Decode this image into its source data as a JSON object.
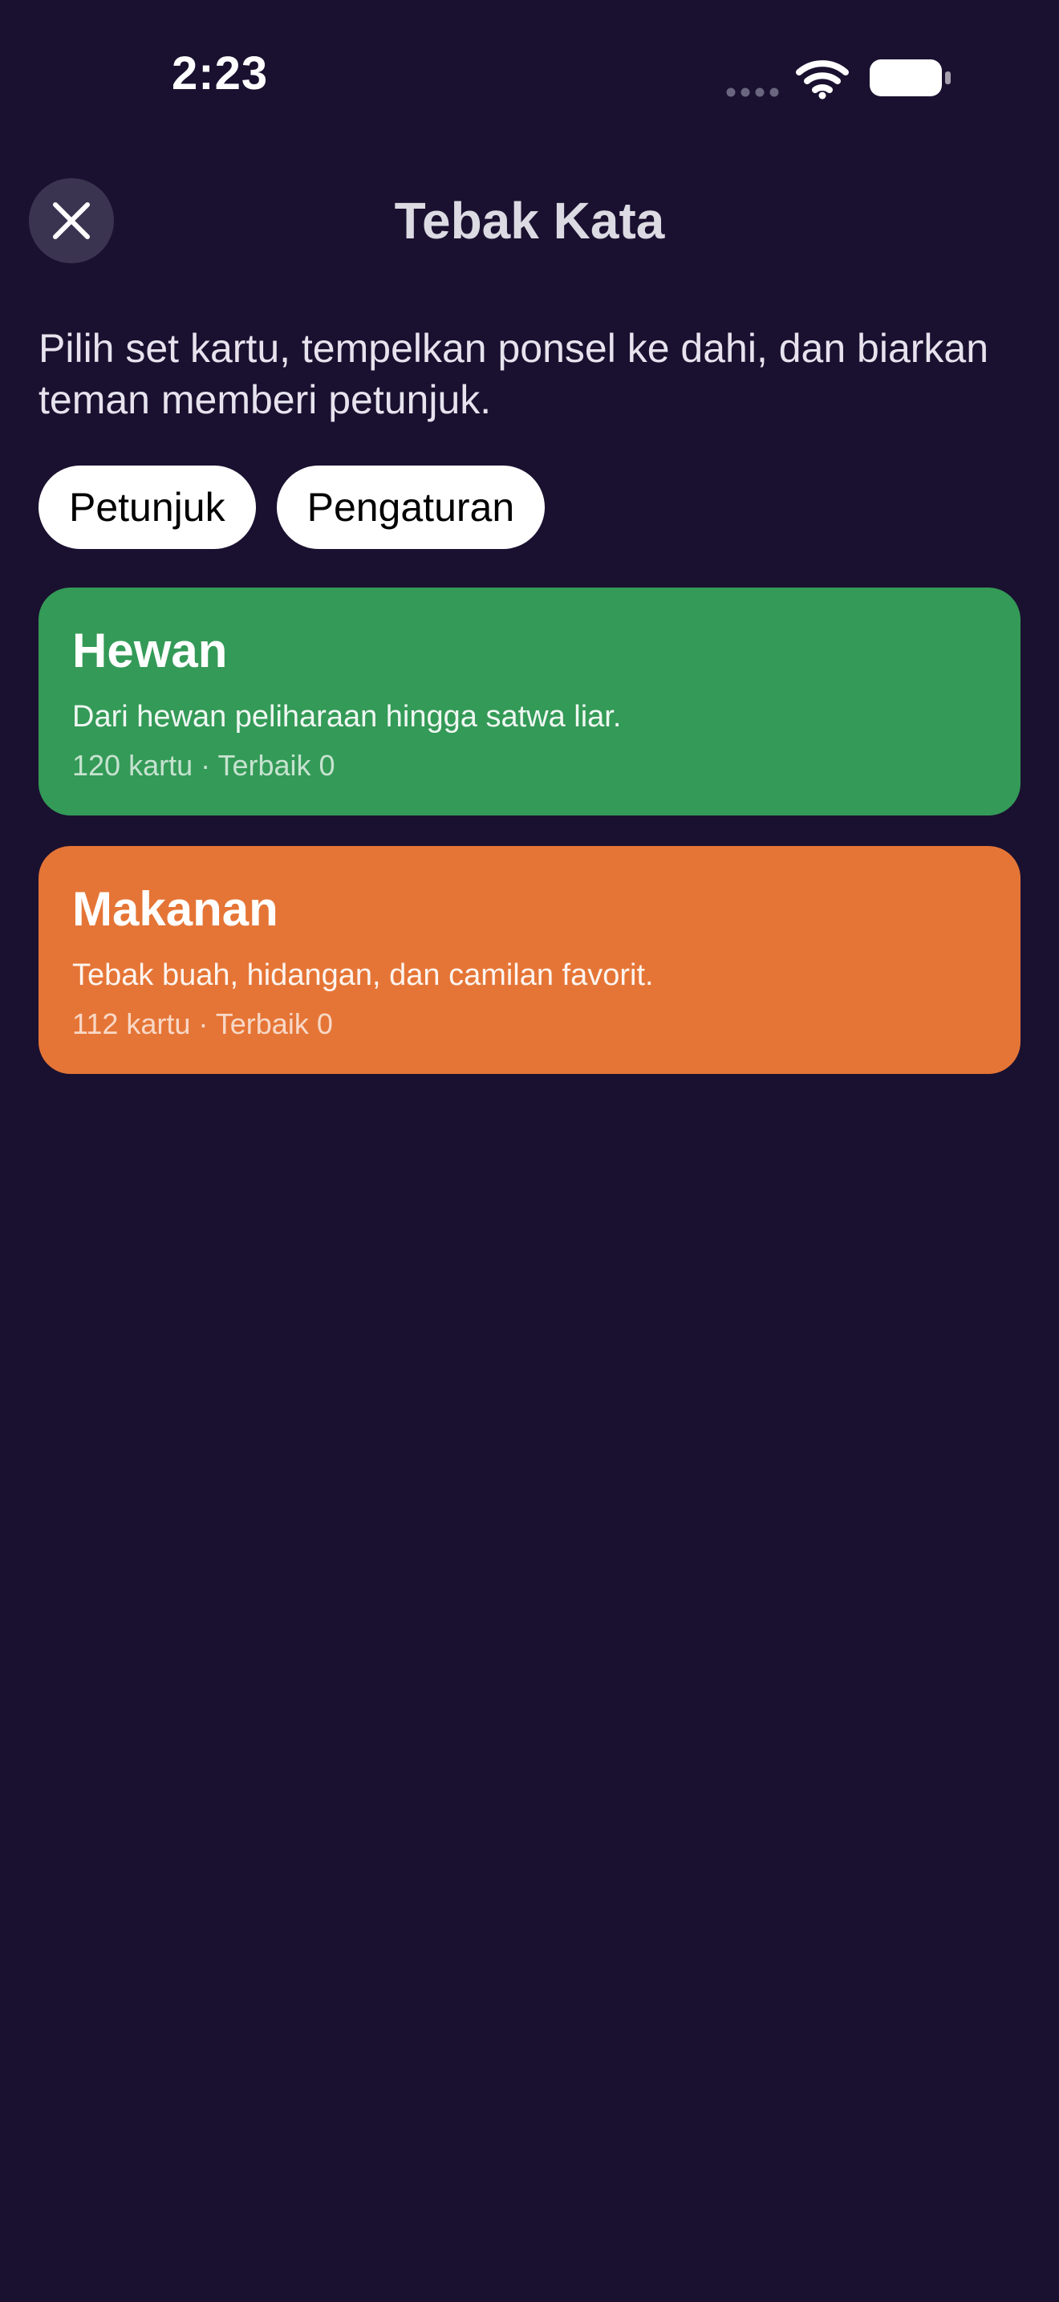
{
  "status_bar": {
    "time": "2:23"
  },
  "header": {
    "title": "Tebak Kata",
    "close_icon": "close-icon"
  },
  "intro": {
    "text": "Pilih set kartu, tempelkan ponsel ke dahi, dan biarkan teman memberi petunjuk."
  },
  "chips": [
    {
      "label": "Petunjuk"
    },
    {
      "label": "Pengaturan"
    }
  ],
  "sets": [
    {
      "name": "Hewan",
      "description": "Dari hewan peliharaan hingga satwa liar.",
      "meta": "120 kartu · Terbaik 0",
      "color": "#349a57"
    },
    {
      "name": "Makanan",
      "description": "Tebak buah, hidangan, dan camilan favorit.",
      "meta": "112 kartu · Terbaik 0",
      "color": "#e57536"
    }
  ],
  "colors": {
    "background": "#1a1130",
    "close_button_bg": "#3b3450",
    "chip_bg": "#ffffff"
  }
}
